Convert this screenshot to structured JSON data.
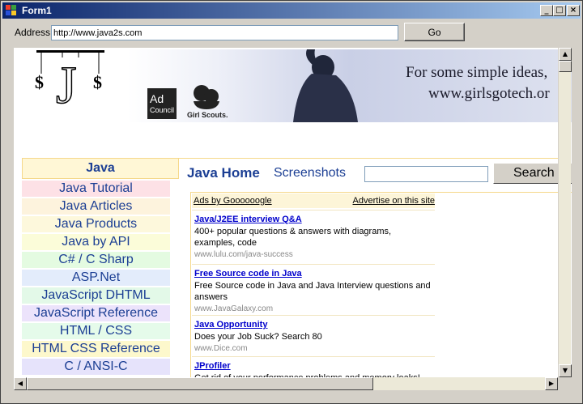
{
  "window": {
    "title": "Form1"
  },
  "toolbar": {
    "address_label": "Address",
    "address_value": "http://www.java2s.com",
    "go_label": "Go"
  },
  "banner": {
    "line1": "For some simple ideas,",
    "line2": "www.girlsgotech.or",
    "adcouncil_line1": "Ad",
    "adcouncil_line2": "Council",
    "girlscouts": "Girl Scouts."
  },
  "nav": {
    "header": "Java",
    "items": [
      {
        "label": "Java Tutorial",
        "color": "#fde1e6"
      },
      {
        "label": "Java Articles",
        "color": "#fdf3dd"
      },
      {
        "label": "Java Products",
        "color": "#fdf8dc"
      },
      {
        "label": "Java by API",
        "color": "#fbfcd9"
      },
      {
        "label": "C# / C Sharp",
        "color": "#e4fbe1"
      },
      {
        "label": "ASP.Net",
        "color": "#e3ecfb"
      },
      {
        "label": "JavaScript DHTML",
        "color": "#e3f9e8"
      },
      {
        "label": "JavaScript Reference",
        "color": "#ece3fb"
      },
      {
        "label": "HTML / CSS",
        "color": "#e5fbea"
      },
      {
        "label": "HTML CSS Reference",
        "color": "#fdf8cc"
      },
      {
        "label": "C / ANSI-C",
        "color": "#e6e3fb"
      }
    ]
  },
  "main": {
    "java_home": "Java Home",
    "screenshots": "Screenshots",
    "search_label": "Search"
  },
  "ads": {
    "header_left": "Ads by Goooooogle",
    "header_right": "Advertise on this site",
    "items": [
      {
        "title": "Java/J2EE interview Q&A",
        "text": "400+ popular questions & answers with diagrams, examples, code",
        "url": "www.lulu.com/java-success"
      },
      {
        "title": "Free Source code in Java",
        "text": "Free Source code in Java and Java Interview questions and answers",
        "url": "www.JavaGalaxy.com"
      },
      {
        "title": "Java Opportunity",
        "text": "Does your Job Suck? Search 80",
        "url": "www.Dice.com"
      },
      {
        "title": "JProfiler",
        "text": "Get rid of your performance problems and memory leaks!",
        "url": ""
      }
    ]
  },
  "colors": {
    "title_bar_start": "#0a246a",
    "title_bar_end": "#a6caf0",
    "nav_text": "#1c3f94",
    "ad_link": "#0000cc"
  }
}
